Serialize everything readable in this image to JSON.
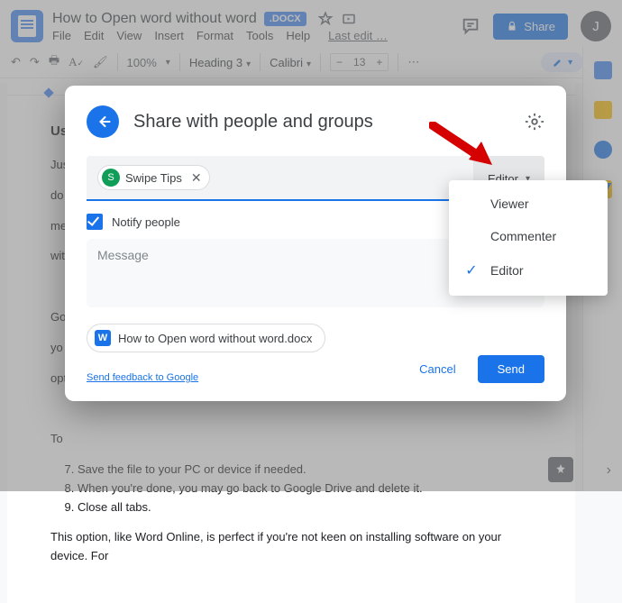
{
  "header": {
    "doc_title": "How to Open word without word",
    "docx_badge": ".DOCX",
    "menus": [
      "File",
      "Edit",
      "View",
      "Insert",
      "Format",
      "Tools",
      "Help"
    ],
    "last_edit": "Last edit …",
    "share_label": "Share",
    "avatar_initial": "J"
  },
  "toolbar": {
    "zoom": "100%",
    "style": "Heading 3",
    "font": "Calibri",
    "font_size": "13"
  },
  "dialog": {
    "title": "Share with people and groups",
    "chip_initial": "S",
    "chip_name": "Swipe Tips",
    "role_button": "Editor",
    "notify_label": "Notify people",
    "message_placeholder": "Message",
    "attachment_icon": "W",
    "attachment_name": "How to Open word without word.docx",
    "feedback": "Send feedback to Google",
    "cancel": "Cancel",
    "send": "Send",
    "role_options": {
      "viewer": "Viewer",
      "commenter": "Commenter",
      "editor": "Editor"
    }
  },
  "doc_body": {
    "heading": "Us",
    "p1": "Jus",
    "p2": "do",
    "p3": "me",
    "p4": "wit",
    "p5": "Go",
    "p6": "yo",
    "p7": "opt",
    "p8": "To",
    "li7": "Save the file to your PC or device if needed.",
    "li8": "When you're done, you may go back to Google Drive and delete it.",
    "li9": "Close all tabs.",
    "footer_p": "This option, like Word Online, is perfect if you're not keen on installing software on your device. For"
  }
}
